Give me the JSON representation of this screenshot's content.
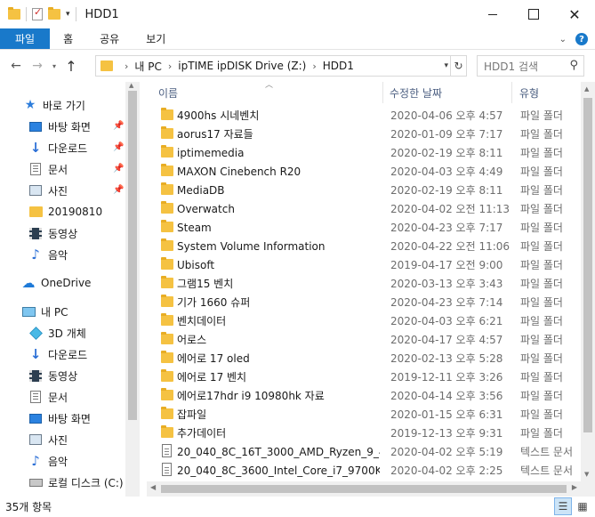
{
  "window": {
    "title": "HDD1",
    "minimize": "",
    "maximize": "",
    "close": "✕"
  },
  "ribbon": {
    "tabs": [
      "파일",
      "홈",
      "공유",
      "보기"
    ],
    "help": "?"
  },
  "address": {
    "crumbs": [
      "내 PC",
      "ipTIME ipDISK Drive (Z:)",
      "HDD1"
    ],
    "search_placeholder": "HDD1 검색"
  },
  "nav": {
    "items": [
      {
        "label": "바로 가기",
        "icon": "star-icon",
        "pinned": false
      },
      {
        "label": "바탕 화면",
        "icon": "desktop-icon",
        "pinned": true
      },
      {
        "label": "다운로드",
        "icon": "download-icon",
        "pinned": true
      },
      {
        "label": "문서",
        "icon": "document-icon",
        "pinned": true
      },
      {
        "label": "사진",
        "icon": "pictures-icon",
        "pinned": true
      },
      {
        "label": "20190810",
        "icon": "folder-icon",
        "pinned": false
      },
      {
        "label": "동영상",
        "icon": "video-icon",
        "pinned": false
      },
      {
        "label": "음악",
        "icon": "music-icon",
        "pinned": false
      },
      {
        "label": "OneDrive",
        "icon": "onedrive-icon",
        "pinned": false
      },
      {
        "label": "내 PC",
        "icon": "pc-icon",
        "pinned": false
      },
      {
        "label": "3D 개체",
        "icon": "3d-objects-icon",
        "pinned": false
      },
      {
        "label": "다운로드",
        "icon": "download-icon",
        "pinned": false
      },
      {
        "label": "동영상",
        "icon": "video-icon",
        "pinned": false
      },
      {
        "label": "문서",
        "icon": "document-icon",
        "pinned": false
      },
      {
        "label": "바탕 화면",
        "icon": "desktop-icon",
        "pinned": false
      },
      {
        "label": "사진",
        "icon": "pictures-icon",
        "pinned": false
      },
      {
        "label": "음악",
        "icon": "music-icon",
        "pinned": false
      },
      {
        "label": "로컬 디스크 (C:)",
        "icon": "drive-icon",
        "pinned": false
      }
    ]
  },
  "columns": {
    "name": "이름",
    "date": "수정한 날짜",
    "type": "유형"
  },
  "files": [
    {
      "name": "4900hs 시네벤치",
      "date": "2020-04-06 오후 4:57",
      "type": "파일 폴더",
      "kind": "folder"
    },
    {
      "name": "aorus17 자료들",
      "date": "2020-01-09 오후 7:17",
      "type": "파일 폴더",
      "kind": "folder"
    },
    {
      "name": "iptimemedia",
      "date": "2020-02-19 오후 8:11",
      "type": "파일 폴더",
      "kind": "folder"
    },
    {
      "name": "MAXON Cinebench R20",
      "date": "2020-04-03 오후 4:49",
      "type": "파일 폴더",
      "kind": "folder"
    },
    {
      "name": "MediaDB",
      "date": "2020-02-19 오후 8:11",
      "type": "파일 폴더",
      "kind": "folder"
    },
    {
      "name": "Overwatch",
      "date": "2020-04-02 오전 11:13",
      "type": "파일 폴더",
      "kind": "folder"
    },
    {
      "name": "Steam",
      "date": "2020-04-23 오후 7:17",
      "type": "파일 폴더",
      "kind": "folder"
    },
    {
      "name": "System Volume Information",
      "date": "2020-04-22 오전 11:06",
      "type": "파일 폴더",
      "kind": "folder"
    },
    {
      "name": "Ubisoft",
      "date": "2019-04-17 오전 9:00",
      "type": "파일 폴더",
      "kind": "folder"
    },
    {
      "name": "그램15 벤치",
      "date": "2020-03-13 오후 3:43",
      "type": "파일 폴더",
      "kind": "folder"
    },
    {
      "name": "기가 1660 슈퍼",
      "date": "2020-04-23 오후 7:14",
      "type": "파일 폴더",
      "kind": "folder"
    },
    {
      "name": "벤치데이터",
      "date": "2020-04-03 오후 6:21",
      "type": "파일 폴더",
      "kind": "folder"
    },
    {
      "name": "어로스",
      "date": "2020-04-17 오후 4:57",
      "type": "파일 폴더",
      "kind": "folder"
    },
    {
      "name": "에어로 17 oled",
      "date": "2020-02-13 오후 5:28",
      "type": "파일 폴더",
      "kind": "folder"
    },
    {
      "name": "에어로 17 벤치",
      "date": "2019-12-11 오후 3:26",
      "type": "파일 폴더",
      "kind": "folder"
    },
    {
      "name": "에어로17hdr i9 10980hk 자료",
      "date": "2020-04-14 오후 3:56",
      "type": "파일 폴더",
      "kind": "folder"
    },
    {
      "name": "잡파일",
      "date": "2020-01-15 오후 6:31",
      "type": "파일 폴더",
      "kind": "folder"
    },
    {
      "name": "추가데이터",
      "date": "2019-12-13 오후 9:31",
      "type": "파일 폴더",
      "kind": "folder"
    },
    {
      "name": "20_040_8C_16T_3000_AMD_Ryzen_9_4...",
      "date": "2020-04-02 오후 5:19",
      "type": "텍스트 문서",
      "kind": "text"
    },
    {
      "name": "20_040_8C_3600_Intel_Core_i7_9700K_...",
      "date": "2020-04-02 오후 2:25",
      "type": "텍스트 문서",
      "kind": "text"
    }
  ],
  "status": {
    "count": "35개 항목"
  }
}
